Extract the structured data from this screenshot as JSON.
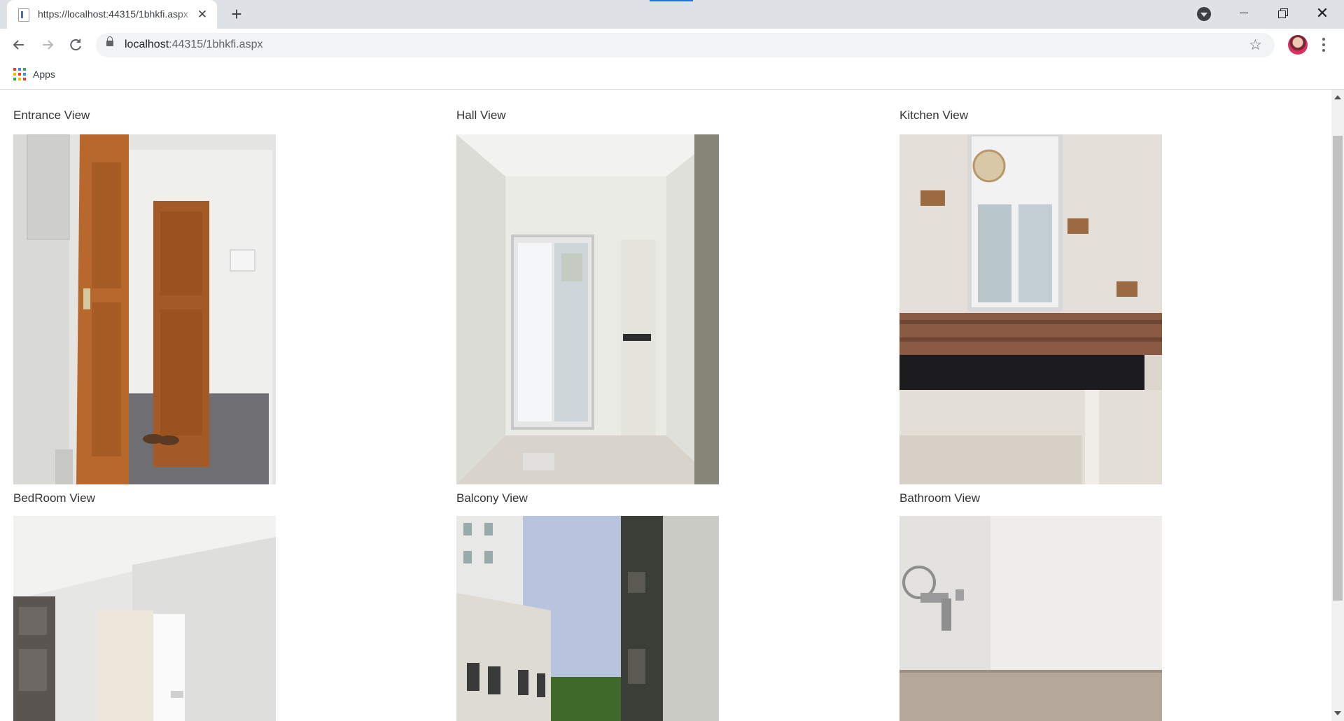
{
  "browser": {
    "tab_title": "https://localhost:44315/1bhkfi.aspx",
    "new_tab_symbol": "+",
    "close_tab_symbol": "✕",
    "url_host": "localhost",
    "url_rest": ":44315/1bhkfi.aspx",
    "bookmarks": [
      {
        "label": "Apps",
        "icon": "apps-grid-icon"
      }
    ],
    "icons": [
      "back-arrow-icon",
      "forward-arrow-icon",
      "reload-icon",
      "lock-icon",
      "star-icon",
      "avatar",
      "menu-dots-icon"
    ],
    "colors": {
      "tab_strip": "#dee1e6",
      "omnibox": "#f1f3f4",
      "load_indicator": "#1a73e8"
    }
  },
  "gallery": [
    {
      "caption": "Entrance View",
      "image": "entrance-photo"
    },
    {
      "caption": "Hall View",
      "image": "hall-photo"
    },
    {
      "caption": "Kitchen View",
      "image": "kitchen-photo"
    },
    {
      "caption": "BedRoom View",
      "image": "bedroom-photo"
    },
    {
      "caption": "Balcony View",
      "image": "balcony-photo"
    },
    {
      "caption": "Bathroom View",
      "image": "bathroom-photo"
    }
  ]
}
